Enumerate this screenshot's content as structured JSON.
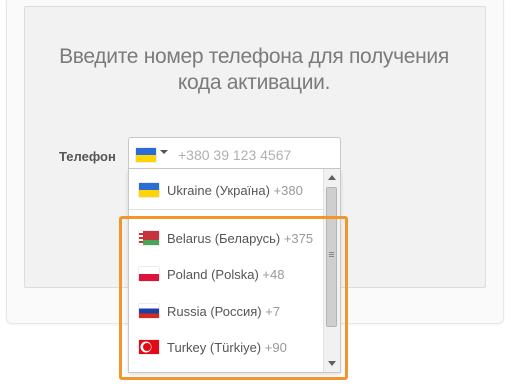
{
  "headline": "Введите номер телефона для получения кода активации.",
  "phone": {
    "label": "Телефон",
    "placeholder": "+380 39 123 4567",
    "selected_flag": "ukraine-flag-icon"
  },
  "dropdown": {
    "preferred": [
      {
        "country": "Ukraine (Україна)",
        "code": "+380",
        "flag": "ukraine-flag-icon"
      }
    ],
    "countries": [
      {
        "country": "Belarus (Беларусь)",
        "code": "+375",
        "flag": "belarus-flag-icon"
      },
      {
        "country": "Poland (Polska)",
        "code": "+48",
        "flag": "poland-flag-icon"
      },
      {
        "country": "Russia (Россия)",
        "code": "+7",
        "flag": "russia-flag-icon"
      },
      {
        "country": "Turkey (Türkiye)",
        "code": "+90",
        "flag": "turkey-flag-icon"
      }
    ]
  },
  "colors": {
    "highlight": "#f0962d",
    "text": "#555555",
    "headline": "#7b7b7b"
  }
}
